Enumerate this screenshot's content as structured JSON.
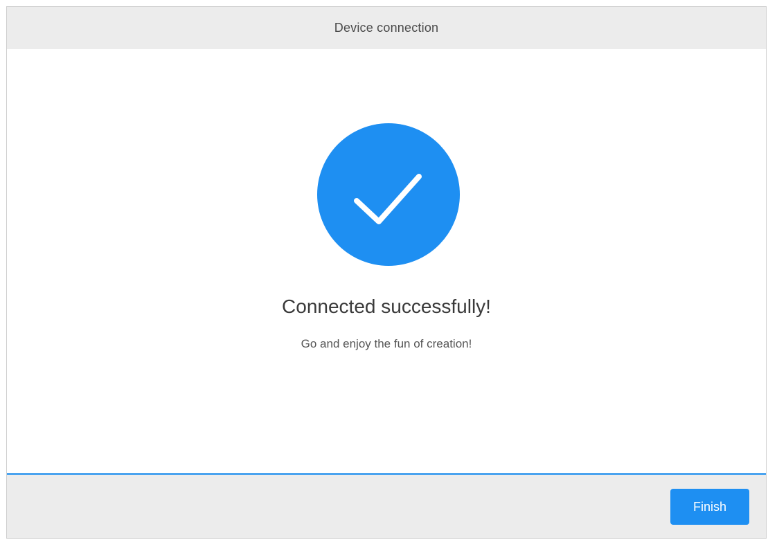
{
  "header": {
    "title": "Device connection"
  },
  "main": {
    "icon": "check-circle-icon",
    "headline": "Connected successfully!",
    "subline": "Go and enjoy the fun of creation!"
  },
  "footer": {
    "finish_label": "Finish"
  },
  "colors": {
    "accent": "#1e8ff2",
    "divider": "#4aa3ef",
    "header_bg": "#ececec",
    "text_primary": "#3a3a3a"
  }
}
